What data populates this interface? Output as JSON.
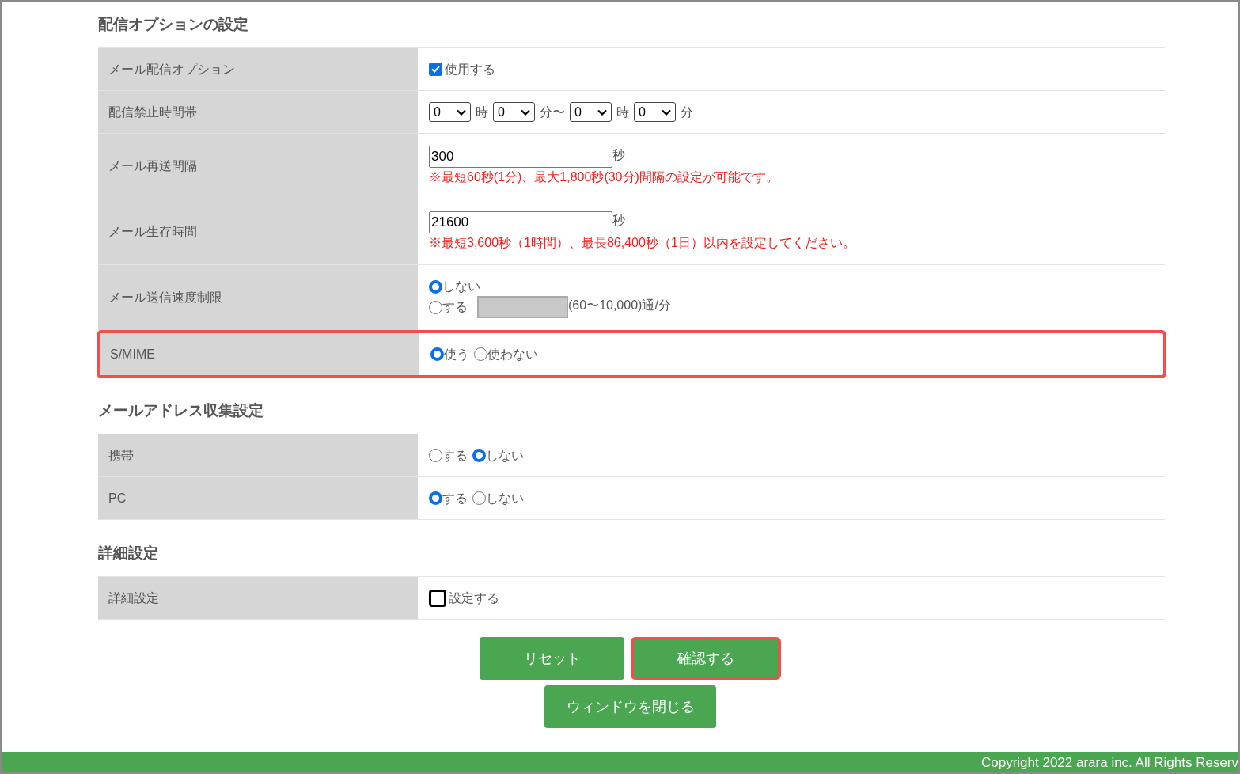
{
  "sections": [
    {
      "title": "配信オプションの設定",
      "rows": [
        {
          "label": "メール配信オプション",
          "highlighted": false,
          "lines": [
            [
              {
                "kind": "checkbox",
                "checked": true,
                "label": "使用する"
              }
            ]
          ]
        },
        {
          "label": "配信禁止時間帯",
          "highlighted": false,
          "lines": [
            [
              {
                "kind": "select",
                "value": "0"
              },
              {
                "kind": "text",
                "text": "時"
              },
              {
                "kind": "select",
                "value": "0"
              },
              {
                "kind": "text",
                "text": "分〜"
              },
              {
                "kind": "select",
                "value": "0"
              },
              {
                "kind": "text",
                "text": "時"
              },
              {
                "kind": "select",
                "value": "0"
              },
              {
                "kind": "text",
                "text": "分"
              }
            ]
          ]
        },
        {
          "label": "メール再送間隔",
          "highlighted": false,
          "lines": [
            [
              {
                "kind": "input",
                "value": "300",
                "disabled": false
              },
              {
                "kind": "unit",
                "text": "秒"
              }
            ],
            [
              {
                "kind": "note",
                "text": "※最短60秒(1分)、最大1,800秒(30分)間隔の設定が可能です。"
              }
            ]
          ]
        },
        {
          "label": "メール生存時間",
          "highlighted": false,
          "lines": [
            [
              {
                "kind": "input",
                "value": "21600",
                "disabled": false
              },
              {
                "kind": "unit",
                "text": "秒"
              }
            ],
            [
              {
                "kind": "note",
                "text": "※最短3,600秒（1時間）、最長86,400秒（1日）以内を設定してください。"
              }
            ]
          ]
        },
        {
          "label": "メール送信速度制限",
          "highlighted": false,
          "lines": [
            [
              {
                "kind": "radio",
                "selected": true,
                "label": "しない"
              }
            ],
            [
              {
                "kind": "radio",
                "selected": false,
                "label": "する"
              },
              {
                "kind": "input",
                "disabled": true
              },
              {
                "kind": "unit",
                "text": "(60〜10,000)通/分"
              }
            ]
          ]
        },
        {
          "label": "S/MIME",
          "highlighted": true,
          "lines": [
            [
              {
                "kind": "radio",
                "selected": true,
                "label": "使う"
              },
              {
                "kind": "radio",
                "selected": false,
                "label": "使わない"
              }
            ]
          ]
        }
      ]
    },
    {
      "title": "メールアドレス収集設定",
      "rows": [
        {
          "label": "携帯",
          "highlighted": false,
          "lines": [
            [
              {
                "kind": "radio",
                "selected": false,
                "label": "する"
              },
              {
                "kind": "radio",
                "selected": true,
                "label": "しない"
              }
            ]
          ]
        },
        {
          "label": "PC",
          "highlighted": false,
          "lines": [
            [
              {
                "kind": "radio",
                "selected": true,
                "label": "する"
              },
              {
                "kind": "radio",
                "selected": false,
                "label": "しない"
              }
            ]
          ]
        }
      ]
    },
    {
      "title": "詳細設定",
      "rows": [
        {
          "label": "詳細設定",
          "highlighted": false,
          "lines": [
            [
              {
                "kind": "checkbox",
                "checked": false,
                "label": "設定する"
              }
            ]
          ]
        }
      ]
    }
  ],
  "buttons": [
    [
      {
        "label": "リセット",
        "highlighted": false
      },
      {
        "label": "確認する",
        "highlighted": true
      }
    ],
    [
      {
        "label": "ウィンドウを閉じる",
        "highlighted": false
      }
    ]
  ],
  "footer": {
    "copyright": "Copyright 2022 arara inc. All Rights Reserv"
  }
}
